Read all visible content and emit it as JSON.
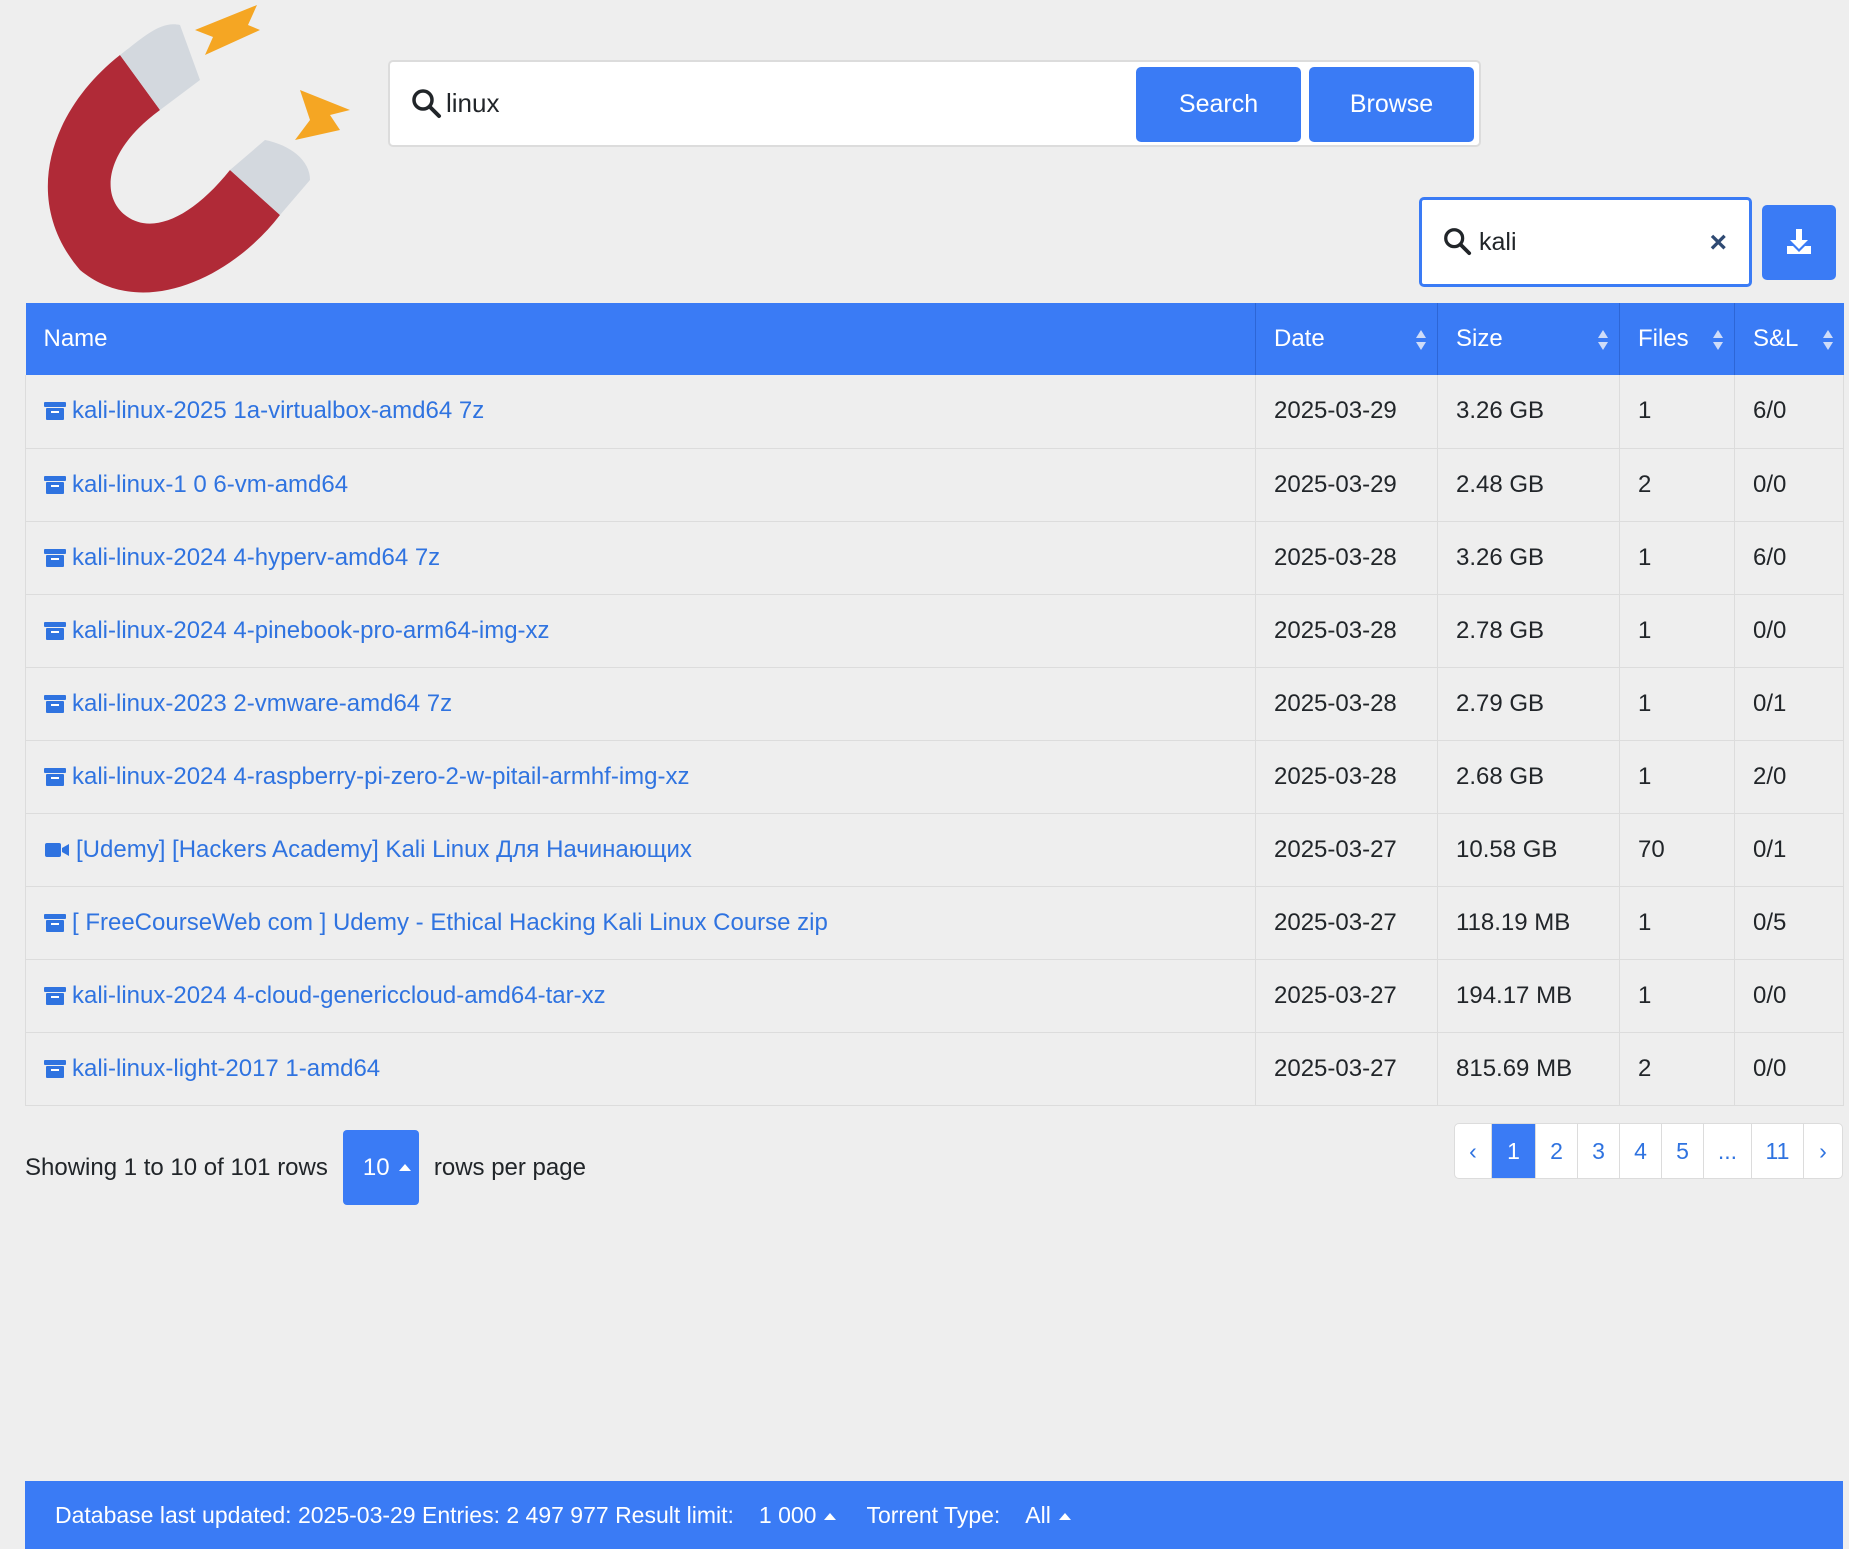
{
  "search": {
    "query": "linux",
    "search_label": "Search",
    "browse_label": "Browse"
  },
  "filter": {
    "value": "kali",
    "clear_glyph": "×"
  },
  "table": {
    "columns": [
      "Name",
      "Date",
      "Size",
      "Files",
      "S&L"
    ],
    "rows": [
      {
        "icon": "archive-icon",
        "name": "kali-linux-2025 1a-virtualbox-amd64 7z",
        "date": "2025-03-29",
        "size": "3.26 GB",
        "files": "1",
        "sl": "6/0"
      },
      {
        "icon": "archive-icon",
        "name": "kali-linux-1 0 6-vm-amd64",
        "date": "2025-03-29",
        "size": "2.48 GB",
        "files": "2",
        "sl": "0/0"
      },
      {
        "icon": "archive-icon",
        "name": "kali-linux-2024 4-hyperv-amd64 7z",
        "date": "2025-03-28",
        "size": "3.26 GB",
        "files": "1",
        "sl": "6/0"
      },
      {
        "icon": "archive-icon",
        "name": "kali-linux-2024 4-pinebook-pro-arm64-img-xz",
        "date": "2025-03-28",
        "size": "2.78 GB",
        "files": "1",
        "sl": "0/0"
      },
      {
        "icon": "archive-icon",
        "name": "kali-linux-2023 2-vmware-amd64 7z",
        "date": "2025-03-28",
        "size": "2.79 GB",
        "files": "1",
        "sl": "0/1"
      },
      {
        "icon": "archive-icon",
        "name": "kali-linux-2024 4-raspberry-pi-zero-2-w-pitail-armhf-img-xz",
        "date": "2025-03-28",
        "size": "2.68 GB",
        "files": "1",
        "sl": "2/0"
      },
      {
        "icon": "video-icon",
        "name": "[Udemy] [Hackers Academy] Kali Linux Для Начинающих",
        "date": "2025-03-27",
        "size": "10.58 GB",
        "files": "70",
        "sl": "0/1"
      },
      {
        "icon": "archive-icon",
        "name": "[ FreeCourseWeb com ] Udemy - Ethical Hacking Kali Linux Course zip",
        "date": "2025-03-27",
        "size": "118.19 MB",
        "files": "1",
        "sl": "0/5"
      },
      {
        "icon": "archive-icon",
        "name": "kali-linux-2024 4-cloud-genericcloud-amd64-tar-xz",
        "date": "2025-03-27",
        "size": "194.17 MB",
        "files": "1",
        "sl": "0/0"
      },
      {
        "icon": "archive-icon",
        "name": "kali-linux-light-2017 1-amd64",
        "date": "2025-03-27",
        "size": "815.69 MB",
        "files": "2",
        "sl": "0/0"
      }
    ]
  },
  "pager": {
    "showing": "Showing 1 to 10 of 101 rows",
    "per_page": "10",
    "per_page_suffix": "rows per page",
    "pages": [
      "‹",
      "1",
      "2",
      "3",
      "4",
      "5",
      "...",
      "11",
      "›"
    ],
    "active": "1"
  },
  "status": {
    "db_label": "Database last updated: 2025-03-29 Entries: 2 497 977 Result limit:",
    "limit_value": "1 000",
    "type_label": "Torrent Type:",
    "type_value": "All"
  },
  "colors": {
    "accent": "#3a7bf5",
    "link": "#2f73e0",
    "magnet_red": "#b02a37",
    "bolt": "#f5a623",
    "background": "#eeeeee"
  }
}
